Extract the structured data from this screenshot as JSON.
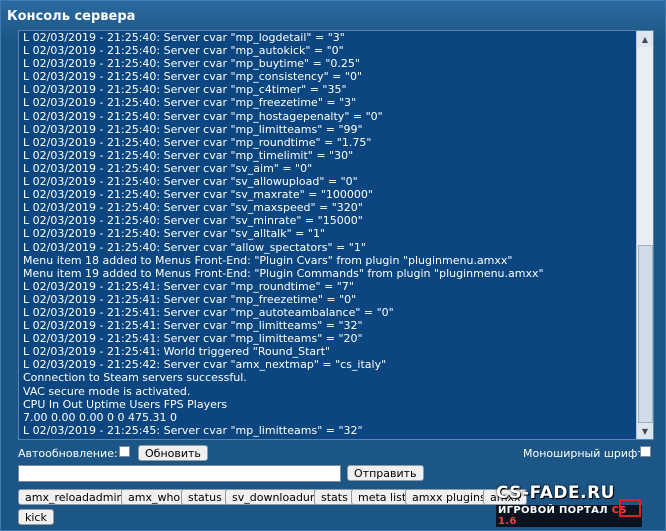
{
  "window": {
    "title": "Консоль сервера"
  },
  "console": {
    "lines": [
      "L 02/03/2019 - 21:25:40: Server cvar \"mp_logdetail\" = \"3\"",
      "L 02/03/2019 - 21:25:40: Server cvar \"mp_autokick\" = \"0\"",
      "L 02/03/2019 - 21:25:40: Server cvar \"mp_buytime\" = \"0.25\"",
      "L 02/03/2019 - 21:25:40: Server cvar \"mp_consistency\" = \"0\"",
      "L 02/03/2019 - 21:25:40: Server cvar \"mp_c4timer\" = \"35\"",
      "L 02/03/2019 - 21:25:40: Server cvar \"mp_freezetime\" = \"3\"",
      "L 02/03/2019 - 21:25:40: Server cvar \"mp_hostagepenalty\" = \"0\"",
      "L 02/03/2019 - 21:25:40: Server cvar \"mp_limitteams\" = \"99\"",
      "L 02/03/2019 - 21:25:40: Server cvar \"mp_roundtime\" = \"1.75\"",
      "L 02/03/2019 - 21:25:40: Server cvar \"mp_timelimit\" = \"30\"",
      "L 02/03/2019 - 21:25:40: Server cvar \"sv_aim\" = \"0\"",
      "L 02/03/2019 - 21:25:40: Server cvar \"sv_allowupload\" = \"0\"",
      "L 02/03/2019 - 21:25:40: Server cvar \"sv_maxrate\" = \"100000\"",
      "L 02/03/2019 - 21:25:40: Server cvar \"sv_maxspeed\" = \"320\"",
      "L 02/03/2019 - 21:25:40: Server cvar \"sv_minrate\" = \"15000\"",
      "L 02/03/2019 - 21:25:40: Server cvar \"sv_alltalk\" = \"1\"",
      "L 02/03/2019 - 21:25:40: Server cvar \"allow_spectators\" = \"1\"",
      "Menu item 18 added to Menus Front-End: \"Plugin Cvars\" from plugin \"pluginmenu.amxx\"",
      "Menu item 19 added to Menus Front-End: \"Plugin Commands\" from plugin \"pluginmenu.amxx\"",
      "L 02/03/2019 - 21:25:41: Server cvar \"mp_roundtime\" = \"7\"",
      "L 02/03/2019 - 21:25:41: Server cvar \"mp_freezetime\" = \"0\"",
      "L 02/03/2019 - 21:25:41: Server cvar \"mp_autoteambalance\" = \"0\"",
      "L 02/03/2019 - 21:25:41: Server cvar \"mp_limitteams\" = \"32\"",
      "L 02/03/2019 - 21:25:41: Server cvar \"mp_limitteams\" = \"20\"",
      "L 02/03/2019 - 21:25:41: World triggered \"Round_Start\"",
      "L 02/03/2019 - 21:25:42: Server cvar \"amx_nextmap\" = \"cs_italy\"",
      "Connection to Steam servers successful.",
      "VAC secure mode is activated.",
      "CPU In Out Uptime Users FPS Players",
      "7.00 0.00 0.00 0 0 475.31 0",
      "L 02/03/2019 - 21:25:45: Server cvar \"mp_limitteams\" = \"32\""
    ]
  },
  "controls": {
    "auto_refresh_label": "Автообновление:",
    "refresh_button": "Обновить",
    "monospace_label": "Моноширный шрифт:",
    "send_button": "Отправить",
    "command_value": ""
  },
  "commands": [
    "amx_reloadadmins",
    "amx_who",
    "status",
    "sv_downloadurl",
    "stats",
    "meta list",
    "amxx plugins",
    "amxx",
    "kick"
  ],
  "watermark": {
    "main": "CS-FADE.RU",
    "sub_prefix": "ИГРОВОЙ ПОРТАЛ ",
    "sub_accent": "CS 1.6"
  }
}
